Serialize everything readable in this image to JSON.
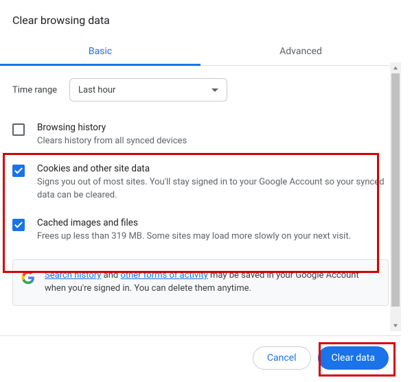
{
  "title": "Clear browsing data",
  "tabs": {
    "basic": "Basic",
    "advanced": "Advanced"
  },
  "time": {
    "label": "Time range",
    "value": "Last hour"
  },
  "options": [
    {
      "title": "Browsing history",
      "desc": "Clears history from all synced devices",
      "checked": false
    },
    {
      "title": "Cookies and other site data",
      "desc": "Signs you out of most sites. You'll stay signed in to your Google Account so your synced data can be cleared.",
      "checked": true
    },
    {
      "title": "Cached images and files",
      "desc": "Frees up less than 319 MB. Some sites may load more slowly on your next visit.",
      "checked": true
    }
  ],
  "info": {
    "link1": "Search history",
    "mid1": " and ",
    "link2": "other forms of activity",
    "rest": " may be saved in your Google Account when you're signed in. You can delete them anytime."
  },
  "buttons": {
    "cancel": "Cancel",
    "clear": "Clear data"
  }
}
